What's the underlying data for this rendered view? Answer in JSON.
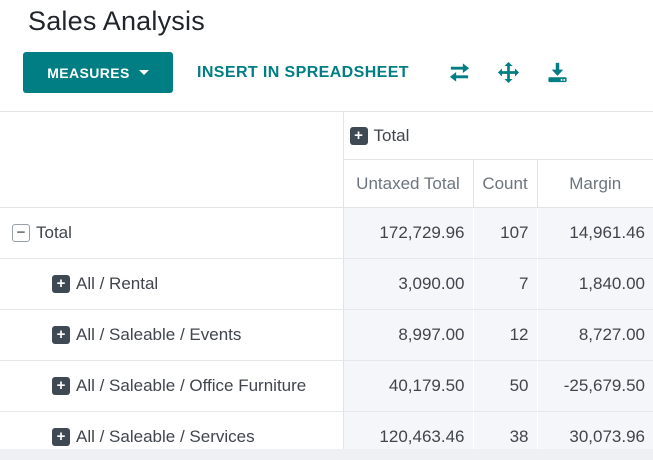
{
  "page_title": "Sales Analysis",
  "toolbar": {
    "measures_label": "MEASURES",
    "insert_spreadsheet_label": "INSERT IN SPREADSHEET",
    "icon_names": [
      "flip-axes-icon",
      "expand-all-icon",
      "download-icon"
    ]
  },
  "colors": {
    "accent_teal": "#017e84",
    "cell_background": "#f5f6f9",
    "muted_header_text": "#6c757d",
    "dark_text": "#40454d",
    "tree_plus_background": "#3e4954"
  },
  "pivot_table": {
    "column_group": {
      "label": "Total",
      "state": "collapsed"
    },
    "measure_headers": [
      "Untaxed Total",
      "Count",
      "Margin"
    ],
    "rows": [
      {
        "label": "Total",
        "level": 0,
        "state": "expanded",
        "values": [
          "172,729.96",
          "107",
          "14,961.46"
        ]
      },
      {
        "label": "All / Rental",
        "level": 1,
        "state": "collapsed",
        "values": [
          "3,090.00",
          "7",
          "1,840.00"
        ]
      },
      {
        "label": "All / Saleable / Events",
        "level": 1,
        "state": "collapsed",
        "values": [
          "8,997.00",
          "12",
          "8,727.00"
        ]
      },
      {
        "label": "All / Saleable / Office Furniture",
        "level": 1,
        "state": "collapsed",
        "values": [
          "40,179.50",
          "50",
          "-25,679.50"
        ]
      },
      {
        "label": "All / Saleable / Services",
        "level": 1,
        "state": "collapsed",
        "values": [
          "120,463.46",
          "38",
          "30,073.96"
        ]
      }
    ]
  }
}
